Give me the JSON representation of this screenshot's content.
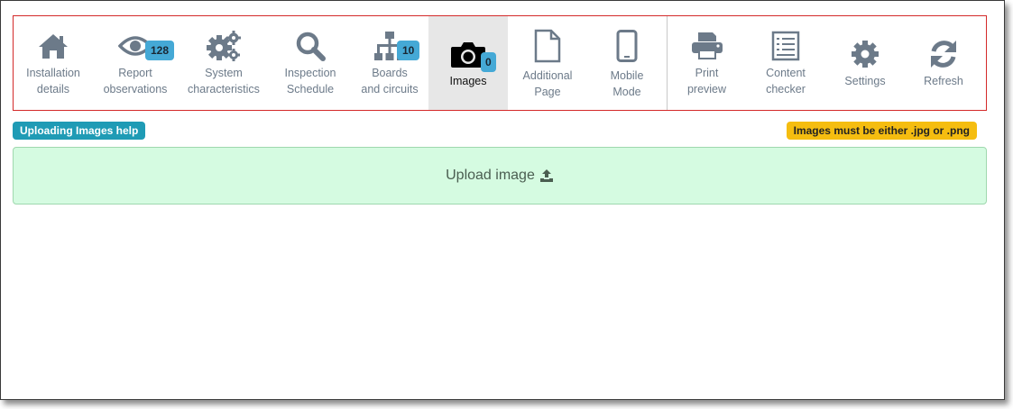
{
  "toolbar": {
    "items": [
      {
        "label": "Installation\ndetails",
        "icon": "home-icon"
      },
      {
        "label": "Report\nobservations",
        "icon": "eye-icon",
        "badge": "128"
      },
      {
        "label": "System\ncharacteristics",
        "icon": "gears-icon"
      },
      {
        "label": "Inspection\nSchedule",
        "icon": "search-icon"
      },
      {
        "label": "Boards\nand circuits",
        "icon": "sitemap-icon",
        "badge": "10"
      },
      {
        "label": "Images",
        "icon": "camera-icon",
        "badge": "0",
        "active": true
      },
      {
        "label": "Additional\nPage",
        "icon": "file-icon"
      },
      {
        "label": "Mobile\nMode",
        "icon": "mobile-icon"
      },
      {
        "label": "Print\npreview",
        "icon": "print-icon"
      },
      {
        "label": "Content\nchecker",
        "icon": "checklist-icon"
      },
      {
        "label": "Settings",
        "icon": "gear-icon"
      },
      {
        "label": "Refresh",
        "icon": "refresh-icon"
      }
    ]
  },
  "help": {
    "label": "Uploading Images help"
  },
  "warning": {
    "label": "Images must be either .jpg or .png"
  },
  "upload": {
    "label": "Upload image",
    "icon": "upload-icon"
  },
  "colors": {
    "toolbar_border": "#d42a2a",
    "icon_gray": "#6c7a89",
    "badge_blue": "#45a9d6",
    "help_teal": "#1f9bb5",
    "warn_yellow": "#f5bd10",
    "upload_green": "#d5fbe1"
  }
}
